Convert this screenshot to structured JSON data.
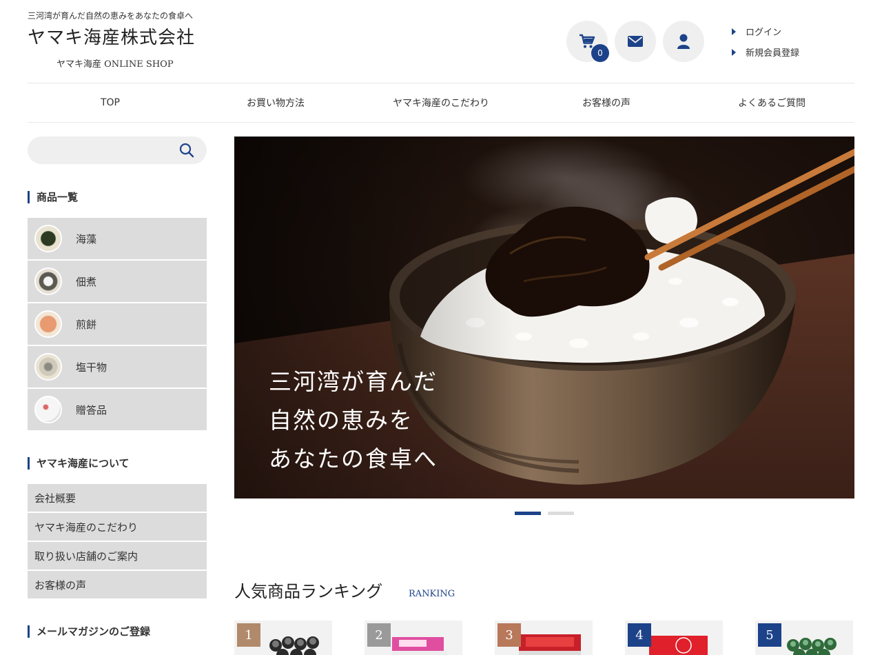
{
  "header": {
    "tagline": "三河湾が育んだ自然の恵みをあなたの食卓へ",
    "logo": "ヤマキ海産株式会社",
    "logo_sub": "ヤマキ海産 ONLINE SHOP",
    "cart_count": "0",
    "login": "ログイン",
    "register": "新規会員登録"
  },
  "nav": [
    "TOP",
    "お買い物方法",
    "ヤマキ海産のこだわり",
    "お客様の声",
    "よくあるご質問"
  ],
  "search": {
    "placeholder": ""
  },
  "sidebar": {
    "products_heading": "商品一覧",
    "categories": [
      "海藻",
      "佃煮",
      "煎餅",
      "塩干物",
      "贈答品"
    ],
    "about_heading": "ヤマキ海産について",
    "about_items": [
      "会社概要",
      "ヤマキ海産のこだわり",
      "取り扱い店舗のご案内",
      "お客様の声"
    ],
    "mail_heading": "メールマガジンのご登録"
  },
  "hero": {
    "lines": [
      "三河湾が育んだ",
      "自然の恵みを",
      "あなたの食卓へ"
    ],
    "slide_count": 2,
    "active_slide": 1
  },
  "ranking": {
    "title": "人気商品ランキング",
    "subtitle": "RANKING",
    "items": [
      {
        "rank": "1",
        "color": "#b08a6a"
      },
      {
        "rank": "2",
        "color": "#9a9a9a"
      },
      {
        "rank": "3",
        "color": "#b8785a"
      },
      {
        "rank": "4",
        "color": "#1c4289"
      },
      {
        "rank": "5",
        "color": "#1c4289"
      }
    ]
  },
  "colors": {
    "accent": "#1c4289",
    "sidebar_bg": "#dcdcdc",
    "circle_bg": "#efefef"
  }
}
